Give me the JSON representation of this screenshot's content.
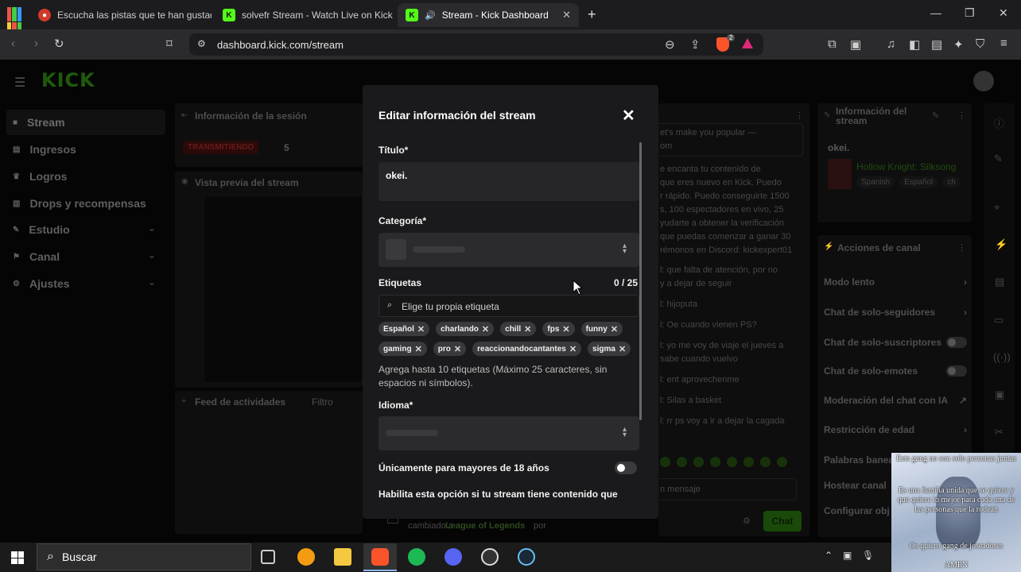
{
  "browser": {
    "tabs": [
      {
        "label": "Escucha las pistas que te han gustado",
        "icon": "audio-site-icon",
        "active": false
      },
      {
        "label": "solvefr Stream - Watch Live on Kick",
        "icon": "kick-icon",
        "active": false
      },
      {
        "label": "Stream - Kick Dashboard",
        "icon": "kick-icon",
        "active": true
      }
    ],
    "url": "dashboard.kick.com/stream",
    "new_tab": "+",
    "close_tab": "✕",
    "shield_badge": "2"
  },
  "sidebar": {
    "logo": "KICK",
    "items": [
      {
        "label": "Stream",
        "icon": "stream-icon"
      },
      {
        "label": "Ingresos",
        "icon": "income-icon"
      },
      {
        "label": "Logros",
        "icon": "trophy-icon"
      },
      {
        "label": "Drops y recompensas",
        "icon": "drops-icon"
      },
      {
        "label": "Estudio",
        "icon": "studio-icon",
        "chevron": true
      },
      {
        "label": "Canal",
        "icon": "channel-icon",
        "chevron": true
      },
      {
        "label": "Ajustes",
        "icon": "settings-icon",
        "chevron": true
      }
    ]
  },
  "background": {
    "session_title": "Información de la sesión",
    "live_badge": "TRANSMITIENDO",
    "session_count": "5",
    "preview_title": "Vista previa del stream",
    "feed_title": "Feed de actividades",
    "feed_filter": "Filtro",
    "feed_line_game": "League of Legends",
    "feed_line_prefix": "cambiado a",
    "feed_line_suffix": "por",
    "chat_lines": [
      "et's make you popular —",
      "om",
      "e encanta tu contenido de",
      "que eres nuevo en Kick. Puedo",
      "r rápido. Puedo conseguirte 1500",
      "s, 100 espectadores en vivo, 25",
      "yudarte a obtener la verificación",
      "que puedas comenzar a ganar 30",
      "rémonos en Discord: kickexpert01",
      "l: que falta de atención, por no",
      "y a dejar de seguir",
      "l: hijoputa",
      "l: Oe cuando vienen PS?",
      "l: yo me voy de viaje el jueves a",
      "sabe cuando vuelvo",
      "l: ent aprovechenme",
      "l: Silas a basket",
      "l: rr ps voy a ir a dejar la cagada"
    ],
    "chat_placeholder": "n mensaje",
    "chat_button": "Chat",
    "info_title": "Información del stream",
    "info_stream_title": "okei.",
    "info_game": "Hollow Knight: Silksong",
    "info_tags": [
      "Spanish",
      "Español",
      "ch"
    ],
    "actions_title": "Acciones de canal",
    "actions": [
      {
        "label": "Modo lento",
        "kind": "chevron"
      },
      {
        "label": "Chat de solo-seguidores",
        "kind": "chevron"
      },
      {
        "label": "Chat de solo-suscriptores",
        "kind": "toggle"
      },
      {
        "label": "Chat de solo-emotes",
        "kind": "toggle"
      },
      {
        "label": "Moderación del chat con IA",
        "kind": "external"
      },
      {
        "label": "Restricción de edad",
        "kind": "chevron"
      },
      {
        "label": "Palabras banea",
        "kind": "none"
      },
      {
        "label": "Hostear canal",
        "kind": "none"
      },
      {
        "label": "Configurar obj",
        "kind": "none"
      }
    ]
  },
  "modal": {
    "title": "Editar información del stream",
    "title_label": "Título*",
    "title_value": "okei.",
    "category_label": "Categoría*",
    "tags_label": "Etiquetas",
    "tags_count": "0 / 25",
    "tags_placeholder": "Elige tu propia etiqueta",
    "tags": [
      "Español",
      "charlando",
      "chill",
      "fps",
      "funny",
      "gaming",
      "pro",
      "reaccionandocantantes",
      "sigma"
    ],
    "tags_helper": "Agrega hasta 10 etiquetas (Máximo 25 caracteres, sin espacios ni símbolos).",
    "language_label": "Idioma*",
    "adult_label": "Únicamente para mayores de 18 años",
    "adult_enabled": false,
    "adult_help": "Habilita esta opción si tu stream tiene contenido que"
  },
  "taskbar": {
    "search_label": "Buscar",
    "apps": [
      "task-view-icon",
      "fl-studio-icon",
      "file-explorer-icon",
      "brave-icon",
      "spotify-icon",
      "discord-icon",
      "obs-icon",
      "steam-icon"
    ]
  },
  "overlay": {
    "lines": [
      "Esta gang no son solo personas juntas",
      "Es una familia unida que se quiere y que quiere lo mejor para cada una de las personas que la rodean",
      "Os quiero gang de joseadores",
      "AMEN"
    ]
  },
  "colors": {
    "accent": "#53fc18",
    "modal_bg": "#1a1a1c",
    "live_red": "#e53935"
  }
}
